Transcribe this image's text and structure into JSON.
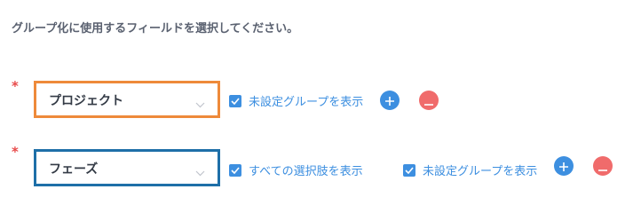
{
  "instruction": "グループ化に使用するフィールドを選択してください。",
  "colors": {
    "required": "#e84a4a",
    "accent": "#3d8fe0",
    "row1_border": "#ee8a3a",
    "row2_border": "#1e6fa8",
    "remove": "#f06b6b"
  },
  "rows": [
    {
      "required_mark": "*",
      "select_value": "プロジェクト",
      "checkboxes": [
        {
          "label": "未設定グループを表示",
          "checked": true
        }
      ]
    },
    {
      "required_mark": "*",
      "select_value": "フェーズ",
      "checkboxes": [
        {
          "label": "すべての選択肢を表示",
          "checked": true
        },
        {
          "label": "未設定グループを表示",
          "checked": true
        }
      ]
    }
  ]
}
